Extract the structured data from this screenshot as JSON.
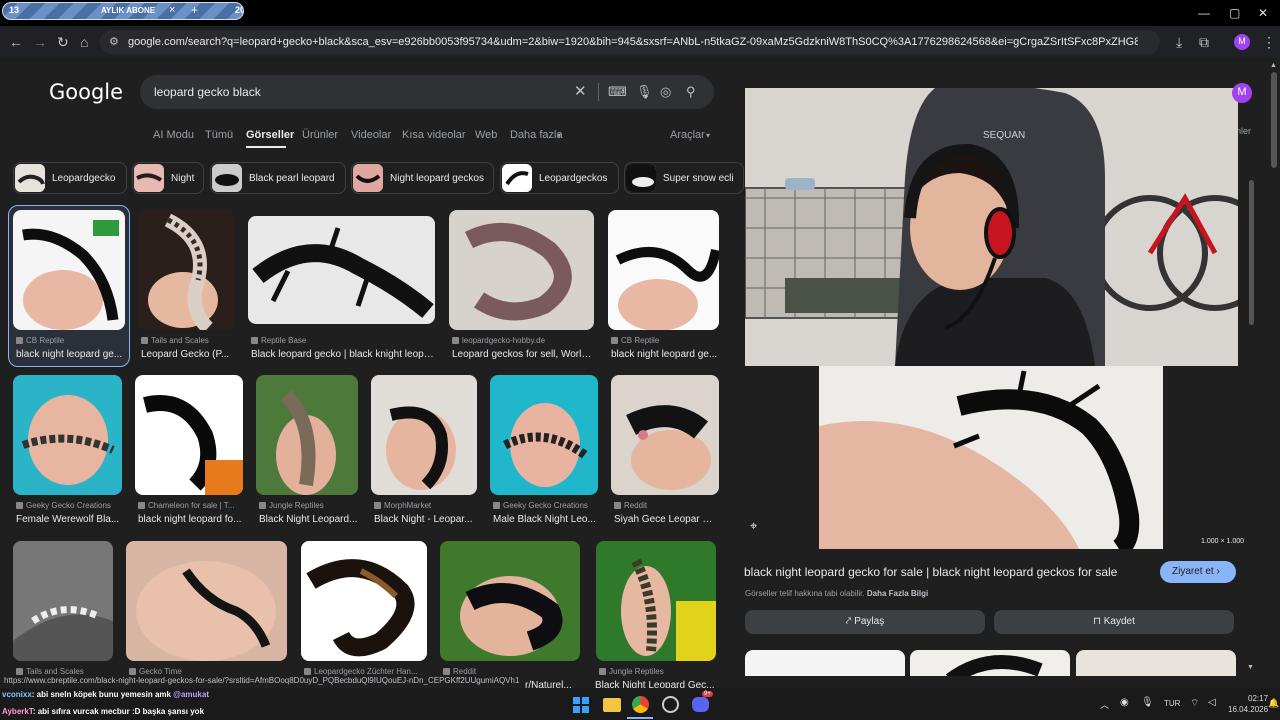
{
  "browser": {
    "tab": {
      "count_left": "13",
      "label": "AYLIK ABONE",
      "close": "×",
      "new_tab": "+",
      "count_right": "20"
    },
    "url": "google.com/search?q=leopard+gecko+black&sca_esv=e926bb0053f95734&udm=2&biw=1920&bih=945&sxsrf=ANbL-n5tkaGZ-09xaMz5GdzkniW8ThS0CQ%3A1776298624568&ei=gCrgaZSrItSFxc8PxZHG8AE&ved=0ahUKEwiU66CEjPGTAxXU...",
    "profile_initial": "M"
  },
  "google": {
    "logo": "Google",
    "query": "leopard gecko black",
    "tabs": [
      "AI Modu",
      "Tümü",
      "Görseller",
      "Ürünler",
      "Videolar",
      "Kısa videolar",
      "Web",
      "Daha fazla",
      "Araçlar"
    ],
    "chips": [
      "Leopardgecko",
      "Night",
      "Black pearl leopard",
      "Night leopard geckos",
      "Leopardgeckos",
      "Super snow ecli"
    ],
    "results": [
      {
        "src": "CB Reptile",
        "cap": "black night leopard ge..."
      },
      {
        "src": "Tails and Scales",
        "cap": "Leopard Gecko (P..."
      },
      {
        "src": "Reptile Base",
        "cap": "Black leopard gecko | black knight leopa..."
      },
      {
        "src": "leopardgecko-hobby.de",
        "cap": "Leopard geckos for sell, World..."
      },
      {
        "src": "CB Reptile",
        "cap": "black night leopard ge..."
      },
      {
        "src": "Geeky Gecko Creations",
        "cap": "Female Werewolf Bla..."
      },
      {
        "src": "Chameleon for sale | T...",
        "cap": "black night leopard fo..."
      },
      {
        "src": "Jungle Reptiles",
        "cap": "Black Night Leopard..."
      },
      {
        "src": "MorphMarket",
        "cap": "Black Night - Leopar..."
      },
      {
        "src": "Geeky Gecko Creations",
        "cap": "Male Black Night Leo..."
      },
      {
        "src": "Reddit",
        "cap": "Siyah Gece Leopar G..."
      },
      {
        "src": "Tails and Scales",
        "cap": ""
      },
      {
        "src": "Gecko Time",
        "cap": ""
      },
      {
        "src": "Leopardgecko Züchter Han...",
        "cap": ""
      },
      {
        "src": "Reddit",
        "cap": "r/Naturel..."
      },
      {
        "src": "Jungle Reptiles",
        "cap": "Black Night Leopard Gec..."
      }
    ],
    "status_url": "https://www.cbreptile.com/black-night-leopard-geckos-for-sale/?srsltid=AfmBOoq8D0uyD_PQBecbduQl9IUQouEJ-nDn_CEPGKff2UUgumiAQVh1"
  },
  "panel": {
    "dims": "1.000 × 1.000",
    "title": "black night leopard gecko for sale | black night leopard geckos for sale",
    "visit": "Ziyaret et",
    "note": "Görseller telif hakkına tabi olabilir.",
    "more": "Daha Fazla Bilgi",
    "share": "Paylaş",
    "save": "Kaydet",
    "cam_brand": "SEQUAN"
  },
  "chat": [
    {
      "user": "vconixx",
      "msg": ": abi sneln köpek bunu yemesin amk ",
      "mention": "@amukat"
    },
    {
      "user": "AyberkT",
      "msg": ": abi sıfıra vurcak mecbur :D başka şansı yok",
      "mention": ""
    }
  ],
  "taskbar": {
    "lang": "TUR",
    "time": "02:17",
    "date": "16.04.2026",
    "badge": "9+"
  }
}
